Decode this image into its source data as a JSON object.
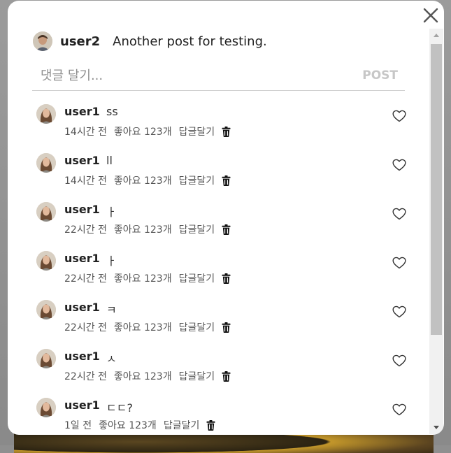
{
  "post": {
    "username": "user2",
    "text": "Another post for testing."
  },
  "comment_form": {
    "placeholder": "댓글 달기...",
    "submit_label": "POST"
  },
  "comments": [
    {
      "username": "user1",
      "text": "ss",
      "time": "14시간 전",
      "likes": "좋아요 123개",
      "reply": "답글달기"
    },
    {
      "username": "user1",
      "text": "ll",
      "time": "14시간 전",
      "likes": "좋아요 123개",
      "reply": "답글달기"
    },
    {
      "username": "user1",
      "text": "ㅏ",
      "time": "22시간 전",
      "likes": "좋아요 123개",
      "reply": "답글달기"
    },
    {
      "username": "user1",
      "text": "ㅏ",
      "time": "22시간 전",
      "likes": "좋아요 123개",
      "reply": "답글달기"
    },
    {
      "username": "user1",
      "text": "ㅋ",
      "time": "22시간 전",
      "likes": "좋아요 123개",
      "reply": "답글달기"
    },
    {
      "username": "user1",
      "text": "ㅅ",
      "time": "22시간 전",
      "likes": "좋아요 123개",
      "reply": "답글달기"
    },
    {
      "username": "user1",
      "text": "ㄷㄷ?",
      "time": "1일 전",
      "likes": "좋아요 123개",
      "reply": "답글달기"
    }
  ],
  "icons": {
    "close": "close-icon",
    "heart": "heart-icon",
    "trash": "trash-icon",
    "avatar": "avatar"
  },
  "colors": {
    "muted_text": "#555555",
    "post_button_disabled": "#c7c7c7",
    "scrollbar_thumb": "#c1c1c1"
  }
}
